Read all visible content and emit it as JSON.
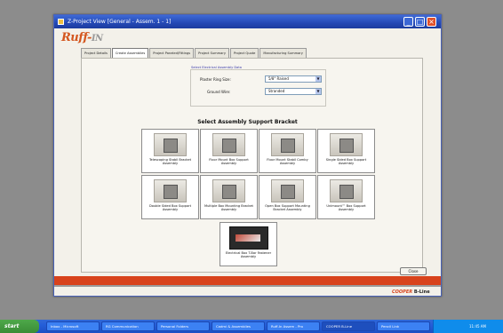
{
  "window": {
    "title": "Z-Project View [General - Assem. 1 - 1]"
  },
  "logo": {
    "brand": "Ruff-",
    "suffix": "IN"
  },
  "tabs": [
    {
      "label": "Project Details"
    },
    {
      "label": "Create Assemblies"
    },
    {
      "label": "Project Paneled/Fittings"
    },
    {
      "label": "Project Summary"
    },
    {
      "label": "Project Quote"
    },
    {
      "label": "Manufacturing Summary"
    }
  ],
  "options": {
    "legend": "Select Electrical Assembly Data",
    "ring_label": "Plaster Ring Size:",
    "ring_value": "5/8\" Raised",
    "ground_label": "Ground Wire:",
    "ground_value": "Stranded"
  },
  "heading": "Select Assembly Support Bracket",
  "cards": [
    {
      "label": "Telescoping Stabil Bracket Assembly"
    },
    {
      "label": "Floor Mount Box Support Assembly"
    },
    {
      "label": "Floor Mount Stabil Comby Assembly"
    },
    {
      "label": "Single Sided Box Support Assembly"
    },
    {
      "label": "Double Sided Box Support Assembly"
    },
    {
      "label": "Multiple Box Mounting Bracket Assembly"
    },
    {
      "label": "Open Box Support Mounting Bracket Assembly"
    },
    {
      "label": "Unimount™ Box Support Assembly"
    },
    {
      "label": "Electrical Box T-Bar Fastener Assembly"
    }
  ],
  "close_label": "Close",
  "brand_footer": {
    "b": "COOPER",
    "rest": " B-Line"
  },
  "taskbar": {
    "start": "start",
    "buttons": [
      {
        "label": "Inbox - Microsoft"
      },
      {
        "label": "RG Communication"
      },
      {
        "label": "Personal Folders"
      },
      {
        "label": "Cadmi & Assemblies"
      },
      {
        "label": "Ruff-In Assem - Pro"
      },
      {
        "label": "COOPER B-Line"
      },
      {
        "label": "Pencil Link"
      }
    ],
    "clock": "11:45 AM"
  }
}
